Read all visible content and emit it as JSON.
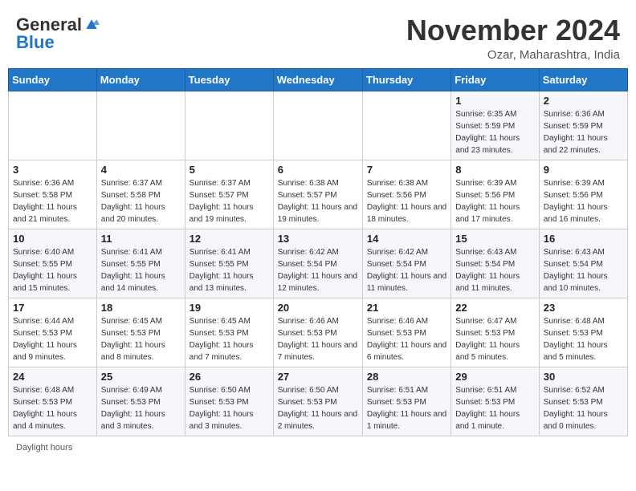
{
  "header": {
    "logo_general": "General",
    "logo_blue": "Blue",
    "month_title": "November 2024",
    "location": "Ozar, Maharashtra, India"
  },
  "days_of_week": [
    "Sunday",
    "Monday",
    "Tuesday",
    "Wednesday",
    "Thursday",
    "Friday",
    "Saturday"
  ],
  "weeks": [
    [
      {
        "day": "",
        "info": ""
      },
      {
        "day": "",
        "info": ""
      },
      {
        "day": "",
        "info": ""
      },
      {
        "day": "",
        "info": ""
      },
      {
        "day": "",
        "info": ""
      },
      {
        "day": "1",
        "info": "Sunrise: 6:35 AM\nSunset: 5:59 PM\nDaylight: 11 hours and 23 minutes."
      },
      {
        "day": "2",
        "info": "Sunrise: 6:36 AM\nSunset: 5:59 PM\nDaylight: 11 hours and 22 minutes."
      }
    ],
    [
      {
        "day": "3",
        "info": "Sunrise: 6:36 AM\nSunset: 5:58 PM\nDaylight: 11 hours and 21 minutes."
      },
      {
        "day": "4",
        "info": "Sunrise: 6:37 AM\nSunset: 5:58 PM\nDaylight: 11 hours and 20 minutes."
      },
      {
        "day": "5",
        "info": "Sunrise: 6:37 AM\nSunset: 5:57 PM\nDaylight: 11 hours and 19 minutes."
      },
      {
        "day": "6",
        "info": "Sunrise: 6:38 AM\nSunset: 5:57 PM\nDaylight: 11 hours and 19 minutes."
      },
      {
        "day": "7",
        "info": "Sunrise: 6:38 AM\nSunset: 5:56 PM\nDaylight: 11 hours and 18 minutes."
      },
      {
        "day": "8",
        "info": "Sunrise: 6:39 AM\nSunset: 5:56 PM\nDaylight: 11 hours and 17 minutes."
      },
      {
        "day": "9",
        "info": "Sunrise: 6:39 AM\nSunset: 5:56 PM\nDaylight: 11 hours and 16 minutes."
      }
    ],
    [
      {
        "day": "10",
        "info": "Sunrise: 6:40 AM\nSunset: 5:55 PM\nDaylight: 11 hours and 15 minutes."
      },
      {
        "day": "11",
        "info": "Sunrise: 6:41 AM\nSunset: 5:55 PM\nDaylight: 11 hours and 14 minutes."
      },
      {
        "day": "12",
        "info": "Sunrise: 6:41 AM\nSunset: 5:55 PM\nDaylight: 11 hours and 13 minutes."
      },
      {
        "day": "13",
        "info": "Sunrise: 6:42 AM\nSunset: 5:54 PM\nDaylight: 11 hours and 12 minutes."
      },
      {
        "day": "14",
        "info": "Sunrise: 6:42 AM\nSunset: 5:54 PM\nDaylight: 11 hours and 11 minutes."
      },
      {
        "day": "15",
        "info": "Sunrise: 6:43 AM\nSunset: 5:54 PM\nDaylight: 11 hours and 11 minutes."
      },
      {
        "day": "16",
        "info": "Sunrise: 6:43 AM\nSunset: 5:54 PM\nDaylight: 11 hours and 10 minutes."
      }
    ],
    [
      {
        "day": "17",
        "info": "Sunrise: 6:44 AM\nSunset: 5:53 PM\nDaylight: 11 hours and 9 minutes."
      },
      {
        "day": "18",
        "info": "Sunrise: 6:45 AM\nSunset: 5:53 PM\nDaylight: 11 hours and 8 minutes."
      },
      {
        "day": "19",
        "info": "Sunrise: 6:45 AM\nSunset: 5:53 PM\nDaylight: 11 hours and 7 minutes."
      },
      {
        "day": "20",
        "info": "Sunrise: 6:46 AM\nSunset: 5:53 PM\nDaylight: 11 hours and 7 minutes."
      },
      {
        "day": "21",
        "info": "Sunrise: 6:46 AM\nSunset: 5:53 PM\nDaylight: 11 hours and 6 minutes."
      },
      {
        "day": "22",
        "info": "Sunrise: 6:47 AM\nSunset: 5:53 PM\nDaylight: 11 hours and 5 minutes."
      },
      {
        "day": "23",
        "info": "Sunrise: 6:48 AM\nSunset: 5:53 PM\nDaylight: 11 hours and 5 minutes."
      }
    ],
    [
      {
        "day": "24",
        "info": "Sunrise: 6:48 AM\nSunset: 5:53 PM\nDaylight: 11 hours and 4 minutes."
      },
      {
        "day": "25",
        "info": "Sunrise: 6:49 AM\nSunset: 5:53 PM\nDaylight: 11 hours and 3 minutes."
      },
      {
        "day": "26",
        "info": "Sunrise: 6:50 AM\nSunset: 5:53 PM\nDaylight: 11 hours and 3 minutes."
      },
      {
        "day": "27",
        "info": "Sunrise: 6:50 AM\nSunset: 5:53 PM\nDaylight: 11 hours and 2 minutes."
      },
      {
        "day": "28",
        "info": "Sunrise: 6:51 AM\nSunset: 5:53 PM\nDaylight: 11 hours and 1 minute."
      },
      {
        "day": "29",
        "info": "Sunrise: 6:51 AM\nSunset: 5:53 PM\nDaylight: 11 hours and 1 minute."
      },
      {
        "day": "30",
        "info": "Sunrise: 6:52 AM\nSunset: 5:53 PM\nDaylight: 11 hours and 0 minutes."
      }
    ]
  ],
  "footer": "Daylight hours"
}
